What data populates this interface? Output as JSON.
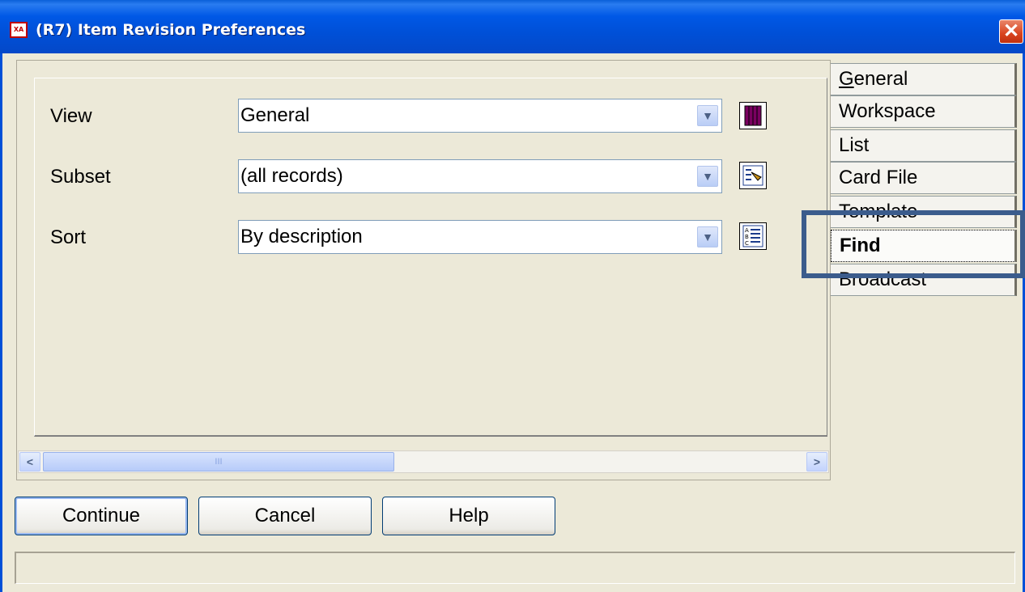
{
  "window": {
    "title": "(R7) Item Revision Preferences",
    "icon_text": "XA",
    "close_glyph": "✕"
  },
  "form": {
    "view": {
      "label": "View",
      "value": "General"
    },
    "subset": {
      "label": "Subset",
      "value": "(all records)"
    },
    "sort": {
      "label": "Sort",
      "value": "By description"
    }
  },
  "scrollbar": {
    "left_arrow": "<",
    "right_arrow": ">",
    "grip": "III"
  },
  "tabs": [
    {
      "label": "General",
      "active": false
    },
    {
      "label": "Workspace",
      "active": false
    },
    {
      "label": "List",
      "active": false
    },
    {
      "label": "Card File",
      "active": false
    },
    {
      "label": "Template",
      "active": false
    },
    {
      "label": "Find",
      "active": true
    },
    {
      "label": "Broadcast",
      "active": false
    }
  ],
  "buttons": {
    "continue": "Continue",
    "cancel": "Cancel",
    "help": "Help"
  },
  "colors": {
    "titlebar": "#0054e3",
    "highlight": "#3b5c8c",
    "face": "#ece9d8"
  }
}
